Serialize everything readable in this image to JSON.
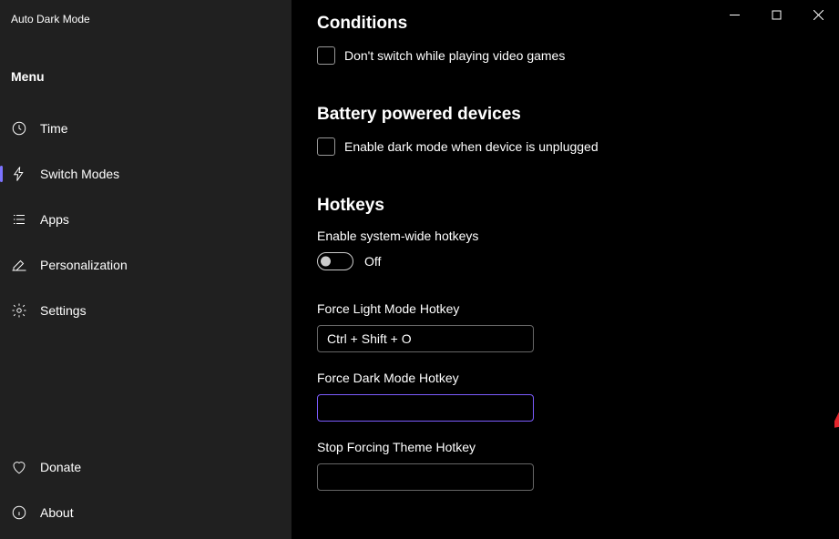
{
  "app": {
    "title": "Auto Dark Mode"
  },
  "sidebar": {
    "menu_label": "Menu",
    "items": [
      {
        "id": "time",
        "label": "Time"
      },
      {
        "id": "switch-modes",
        "label": "Switch Modes",
        "active": true
      },
      {
        "id": "apps",
        "label": "Apps"
      },
      {
        "id": "personalization",
        "label": "Personalization"
      },
      {
        "id": "settings",
        "label": "Settings"
      }
    ],
    "bottom_items": [
      {
        "id": "donate",
        "label": "Donate"
      },
      {
        "id": "about",
        "label": "About"
      }
    ]
  },
  "sections": {
    "conditions": {
      "heading": "Conditions",
      "checkbox_label": "Don't switch while playing video games"
    },
    "battery": {
      "heading": "Battery powered devices",
      "checkbox_label": "Enable dark mode when device is unplugged"
    },
    "hotkeys": {
      "heading": "Hotkeys",
      "enable_label": "Enable system-wide hotkeys",
      "toggle_state": "Off",
      "force_light_label": "Force Light Mode Hotkey",
      "force_light_value": "Ctrl + Shift + O",
      "force_dark_label": "Force Dark Mode Hotkey",
      "force_dark_value": "",
      "stop_forcing_label": "Stop Forcing Theme Hotkey",
      "stop_forcing_value": ""
    }
  },
  "colors": {
    "accent": "#7c5cff",
    "annotation": "#e3242b"
  }
}
